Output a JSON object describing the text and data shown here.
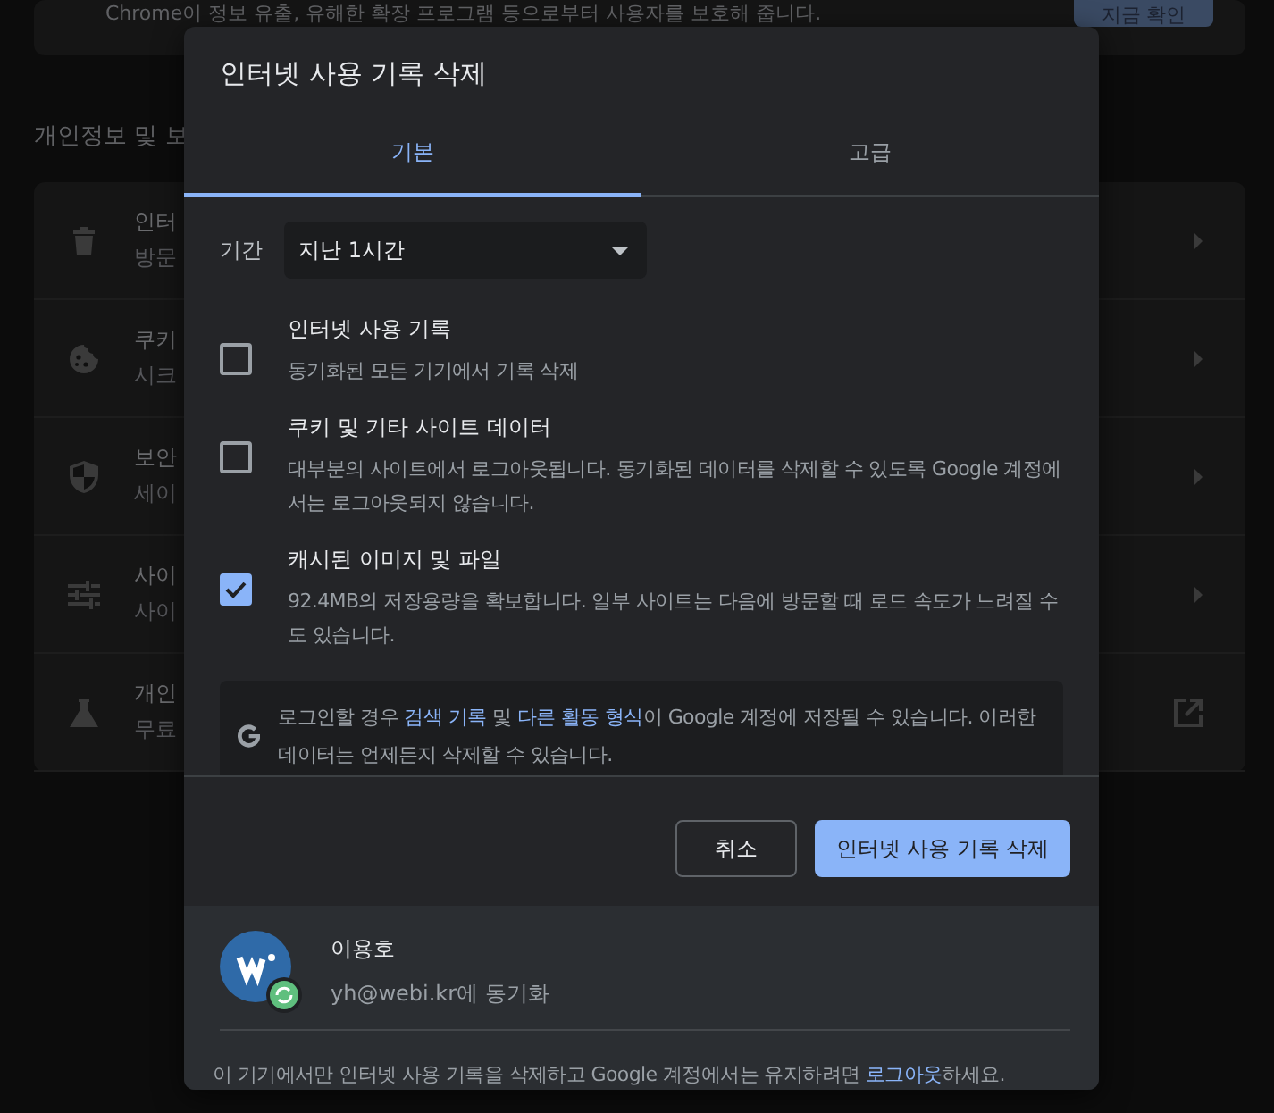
{
  "background": {
    "top_text": "Chrome이 정보 유출, 유해한 확장 프로그램 등으로부터 사용자를 보호해 줍니다.",
    "top_button": "지금 확인",
    "section_title": "개인정보 및 보",
    "rows": [
      {
        "kind": "trash",
        "title": "인터",
        "subtitle": "방문",
        "external_link": false
      },
      {
        "kind": "cookie",
        "title": "쿠키",
        "subtitle": "시크",
        "external_link": false
      },
      {
        "kind": "shield",
        "title": "보안",
        "subtitle": "세이",
        "external_link": false
      },
      {
        "kind": "sliders",
        "title": "사이",
        "subtitle": "사이",
        "external_link": false
      },
      {
        "kind": "flask",
        "title": "개인",
        "subtitle": "무료",
        "external_link": true
      }
    ]
  },
  "dialog": {
    "title": "인터넷 사용 기록 삭제",
    "tabs": [
      {
        "label": "기본",
        "selected": true
      },
      {
        "label": "고급",
        "selected": false
      }
    ],
    "period": {
      "label": "기간",
      "value": "지난 1시간"
    },
    "items": [
      {
        "title": "인터넷 사용 기록",
        "description": "동기화된 모든 기기에서 기록 삭제",
        "checked": false
      },
      {
        "title": "쿠키 및 기타 사이트 데이터",
        "description": "대부분의 사이트에서 로그아웃됩니다. 동기화된 데이터를 삭제할 수 있도록 Google 계정에서는 로그아웃되지 않습니다.",
        "checked": false
      },
      {
        "title": "캐시된 이미지 및 파일",
        "description": "92.4MB의 저장용량을 확보합니다. 일부 사이트는 다음에 방문할 때 로드 속도가 느려질 수도 있습니다.",
        "checked": true
      }
    ],
    "info": [
      {
        "text": "로그인할 경우 ",
        "link": false
      },
      {
        "text": "검색 기록",
        "link": true
      },
      {
        "text": " 및 ",
        "link": false
      },
      {
        "text": "다른 활동 형식",
        "link": true
      },
      {
        "text": "이 Google 계정에 저장될 수 있습니다. 이러한 데이터는 언제든지 삭제할 수 있습니다.",
        "link": false
      }
    ],
    "buttons": [
      {
        "label": "취소",
        "kind": "secondary"
      },
      {
        "label": "인터넷 사용 기록 삭제",
        "kind": "primary"
      }
    ],
    "account": {
      "name": "이용호",
      "email": "yh@webi.kr에 동기화"
    },
    "footer": [
      {
        "text": "이 기기에서만 인터넷 사용 기록을 삭제하고 Google 계정에서는 유지하려면 ",
        "link": false
      },
      {
        "text": "로그아웃",
        "link": true
      },
      {
        "text": "하세요.",
        "link": false
      }
    ]
  }
}
